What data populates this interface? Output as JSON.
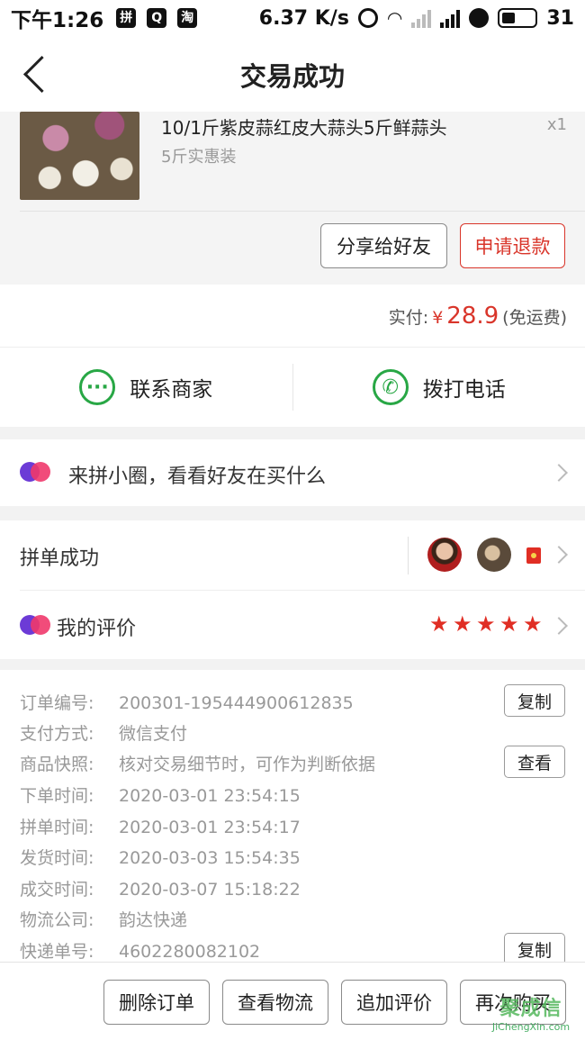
{
  "status_bar": {
    "time": "下午1:26",
    "app_icons": [
      "拼",
      "Q",
      "淘"
    ],
    "speed": "6.37 K/s",
    "battery": "31"
  },
  "nav": {
    "title": "交易成功"
  },
  "product": {
    "name": "10/1斤紫皮蒜红皮大蒜头5斤鲜蒜头",
    "spec": "5斤实惠装",
    "qty": "x1",
    "share_label": "分享给好友",
    "refund_label": "申请退款"
  },
  "payment": {
    "label": "实付:",
    "currency": "¥",
    "amount": "28.9",
    "note": "(免运费)"
  },
  "contact": {
    "merchant_label": "联系商家",
    "call_label": "拨打电话"
  },
  "circle": {
    "text": "来拼小圈，看看好友在买什么"
  },
  "group": {
    "success_label": "拼单成功",
    "review_label": "我的评价",
    "stars": 5
  },
  "order_info": {
    "rows": [
      {
        "key": "订单编号:",
        "value": "200301-195444900612835"
      },
      {
        "key": "支付方式:",
        "value": "微信支付"
      },
      {
        "key": "商品快照:",
        "value": "核对交易细节时，可作为判断依据"
      },
      {
        "key": "下单时间:",
        "value": "2020-03-01 23:54:15"
      },
      {
        "key": "拼单时间:",
        "value": "2020-03-01 23:54:17"
      },
      {
        "key": "发货时间:",
        "value": "2020-03-03 15:54:35"
      },
      {
        "key": "成交时间:",
        "value": "2020-03-07 15:18:22"
      },
      {
        "key": "物流公司:",
        "value": "韵达快递"
      },
      {
        "key": "快递单号:",
        "value": "4602280082102"
      }
    ],
    "copy_label": "复制",
    "view_label": "查看"
  },
  "bottom_actions": {
    "delete": "删除订单",
    "logistics": "查看物流",
    "add_review": "追加评价",
    "buy_again": "再次购买"
  },
  "watermark": {
    "brand": "聚成信",
    "url": "JiChengXin.com"
  },
  "colors": {
    "accent_red": "#d9352a",
    "wechat_green": "#28a745",
    "star_red": "#e02e24"
  }
}
